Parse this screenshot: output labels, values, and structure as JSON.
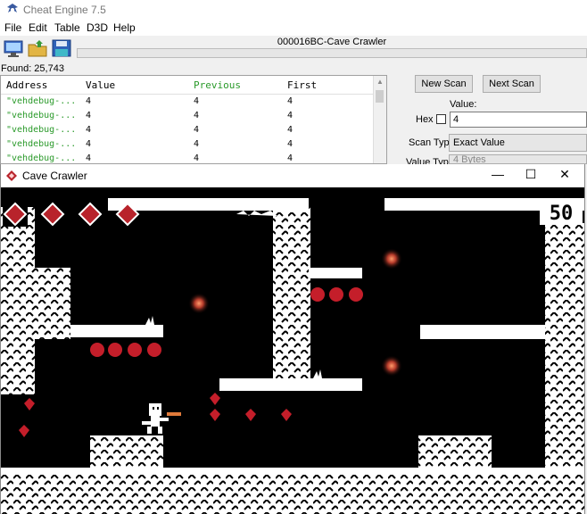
{
  "ce": {
    "title": "Cheat Engine 7.5",
    "menu": [
      "File",
      "Edit",
      "Table",
      "D3D",
      "Help"
    ],
    "process": "000016BC-Cave Crawler",
    "found": "Found: 25,743",
    "columns": [
      "Address",
      "Value",
      "Previous",
      "First"
    ],
    "rows": [
      {
        "address": "\"vehdebug-...",
        "value": "4",
        "previous": "4",
        "first": "4"
      },
      {
        "address": "\"vehdebug-...",
        "value": "4",
        "previous": "4",
        "first": "4"
      },
      {
        "address": "\"vehdebug-...",
        "value": "4",
        "previous": "4",
        "first": "4"
      },
      {
        "address": "\"vehdebug-...",
        "value": "4",
        "previous": "4",
        "first": "4"
      },
      {
        "address": "\"vehdebug-...",
        "value": "4",
        "previous": "4",
        "first": "4"
      }
    ],
    "new_scan": "New Scan",
    "next_scan": "Next Scan",
    "value_label": "Value:",
    "hex_label": "Hex",
    "value_input": "4",
    "scan_type_label": "Scan Type",
    "scan_type_value": "Exact Value",
    "value_type_label": "Value Type",
    "value_type_value": "4 Bytes"
  },
  "game": {
    "title": "Cave Crawler",
    "score": "50",
    "controls": {
      "minimize": "—",
      "maximize": "☐",
      "close": "✕"
    }
  },
  "colors": {
    "gem_red": "#b8232b",
    "fruit_red": "#c41e2a",
    "orb_orange": "#e07a3a",
    "ce_green_text": "#2a9a2a"
  }
}
